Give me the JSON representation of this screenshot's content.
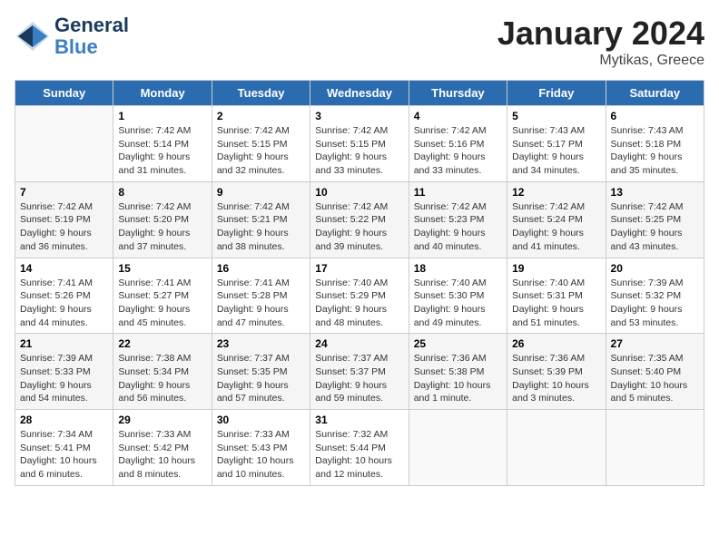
{
  "header": {
    "logo_line1": "General",
    "logo_line2": "Blue",
    "title": "January 2024",
    "subtitle": "Mytikas, Greece"
  },
  "days_of_week": [
    "Sunday",
    "Monday",
    "Tuesday",
    "Wednesday",
    "Thursday",
    "Friday",
    "Saturday"
  ],
  "weeks": [
    [
      {
        "day": "",
        "info": ""
      },
      {
        "day": "1",
        "info": "Sunrise: 7:42 AM\nSunset: 5:14 PM\nDaylight: 9 hours\nand 31 minutes."
      },
      {
        "day": "2",
        "info": "Sunrise: 7:42 AM\nSunset: 5:15 PM\nDaylight: 9 hours\nand 32 minutes."
      },
      {
        "day": "3",
        "info": "Sunrise: 7:42 AM\nSunset: 5:15 PM\nDaylight: 9 hours\nand 33 minutes."
      },
      {
        "day": "4",
        "info": "Sunrise: 7:42 AM\nSunset: 5:16 PM\nDaylight: 9 hours\nand 33 minutes."
      },
      {
        "day": "5",
        "info": "Sunrise: 7:43 AM\nSunset: 5:17 PM\nDaylight: 9 hours\nand 34 minutes."
      },
      {
        "day": "6",
        "info": "Sunrise: 7:43 AM\nSunset: 5:18 PM\nDaylight: 9 hours\nand 35 minutes."
      }
    ],
    [
      {
        "day": "7",
        "info": "Sunrise: 7:42 AM\nSunset: 5:19 PM\nDaylight: 9 hours\nand 36 minutes."
      },
      {
        "day": "8",
        "info": "Sunrise: 7:42 AM\nSunset: 5:20 PM\nDaylight: 9 hours\nand 37 minutes."
      },
      {
        "day": "9",
        "info": "Sunrise: 7:42 AM\nSunset: 5:21 PM\nDaylight: 9 hours\nand 38 minutes."
      },
      {
        "day": "10",
        "info": "Sunrise: 7:42 AM\nSunset: 5:22 PM\nDaylight: 9 hours\nand 39 minutes."
      },
      {
        "day": "11",
        "info": "Sunrise: 7:42 AM\nSunset: 5:23 PM\nDaylight: 9 hours\nand 40 minutes."
      },
      {
        "day": "12",
        "info": "Sunrise: 7:42 AM\nSunset: 5:24 PM\nDaylight: 9 hours\nand 41 minutes."
      },
      {
        "day": "13",
        "info": "Sunrise: 7:42 AM\nSunset: 5:25 PM\nDaylight: 9 hours\nand 43 minutes."
      }
    ],
    [
      {
        "day": "14",
        "info": "Sunrise: 7:41 AM\nSunset: 5:26 PM\nDaylight: 9 hours\nand 44 minutes."
      },
      {
        "day": "15",
        "info": "Sunrise: 7:41 AM\nSunset: 5:27 PM\nDaylight: 9 hours\nand 45 minutes."
      },
      {
        "day": "16",
        "info": "Sunrise: 7:41 AM\nSunset: 5:28 PM\nDaylight: 9 hours\nand 47 minutes."
      },
      {
        "day": "17",
        "info": "Sunrise: 7:40 AM\nSunset: 5:29 PM\nDaylight: 9 hours\nand 48 minutes."
      },
      {
        "day": "18",
        "info": "Sunrise: 7:40 AM\nSunset: 5:30 PM\nDaylight: 9 hours\nand 49 minutes."
      },
      {
        "day": "19",
        "info": "Sunrise: 7:40 AM\nSunset: 5:31 PM\nDaylight: 9 hours\nand 51 minutes."
      },
      {
        "day": "20",
        "info": "Sunrise: 7:39 AM\nSunset: 5:32 PM\nDaylight: 9 hours\nand 53 minutes."
      }
    ],
    [
      {
        "day": "21",
        "info": "Sunrise: 7:39 AM\nSunset: 5:33 PM\nDaylight: 9 hours\nand 54 minutes."
      },
      {
        "day": "22",
        "info": "Sunrise: 7:38 AM\nSunset: 5:34 PM\nDaylight: 9 hours\nand 56 minutes."
      },
      {
        "day": "23",
        "info": "Sunrise: 7:37 AM\nSunset: 5:35 PM\nDaylight: 9 hours\nand 57 minutes."
      },
      {
        "day": "24",
        "info": "Sunrise: 7:37 AM\nSunset: 5:37 PM\nDaylight: 9 hours\nand 59 minutes."
      },
      {
        "day": "25",
        "info": "Sunrise: 7:36 AM\nSunset: 5:38 PM\nDaylight: 10 hours\nand 1 minute."
      },
      {
        "day": "26",
        "info": "Sunrise: 7:36 AM\nSunset: 5:39 PM\nDaylight: 10 hours\nand 3 minutes."
      },
      {
        "day": "27",
        "info": "Sunrise: 7:35 AM\nSunset: 5:40 PM\nDaylight: 10 hours\nand 5 minutes."
      }
    ],
    [
      {
        "day": "28",
        "info": "Sunrise: 7:34 AM\nSunset: 5:41 PM\nDaylight: 10 hours\nand 6 minutes."
      },
      {
        "day": "29",
        "info": "Sunrise: 7:33 AM\nSunset: 5:42 PM\nDaylight: 10 hours\nand 8 minutes."
      },
      {
        "day": "30",
        "info": "Sunrise: 7:33 AM\nSunset: 5:43 PM\nDaylight: 10 hours\nand 10 minutes."
      },
      {
        "day": "31",
        "info": "Sunrise: 7:32 AM\nSunset: 5:44 PM\nDaylight: 10 hours\nand 12 minutes."
      },
      {
        "day": "",
        "info": ""
      },
      {
        "day": "",
        "info": ""
      },
      {
        "day": "",
        "info": ""
      }
    ]
  ]
}
